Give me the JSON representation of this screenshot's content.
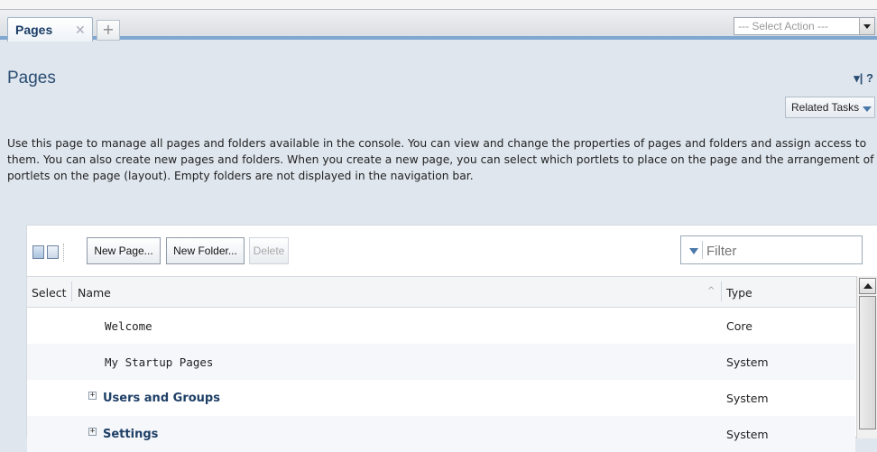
{
  "tabs": [
    {
      "label": "Pages",
      "close": "✕"
    }
  ],
  "add_tab_label": "+",
  "select_action": {
    "value": "--- Select Action ---"
  },
  "page": {
    "title": "Pages",
    "title_icons": "▾| ?",
    "related_tasks": "Related Tasks",
    "description": "Use this page to manage all pages and folders available in the console. You can view and change the properties of pages and folders and assign access to them. You can also create new pages and folders. When you create a new page, you can select which portlets to place on the page and the arrangement of portlets on the page (layout). Empty folders are not displayed in the navigation bar."
  },
  "toolbar": {
    "new_page": "New Page...",
    "new_folder": "New Folder...",
    "delete": "Delete",
    "filter_placeholder": "Filter"
  },
  "table": {
    "columns": {
      "select": "Select",
      "name": "Name",
      "sort_indicator": "^",
      "type": "Type"
    },
    "rows": [
      {
        "name": "Welcome",
        "type": "Core",
        "expandable": false
      },
      {
        "name": "My Startup Pages",
        "type": "System",
        "expandable": false
      },
      {
        "name": "Users and Groups",
        "type": "System",
        "expandable": true
      },
      {
        "name": "Settings",
        "type": "System",
        "expandable": true
      }
    ]
  },
  "colors": {
    "title": "#2a4d72",
    "tab_accent": "#7fa7cf",
    "row_alt": "#f5f7fa"
  }
}
